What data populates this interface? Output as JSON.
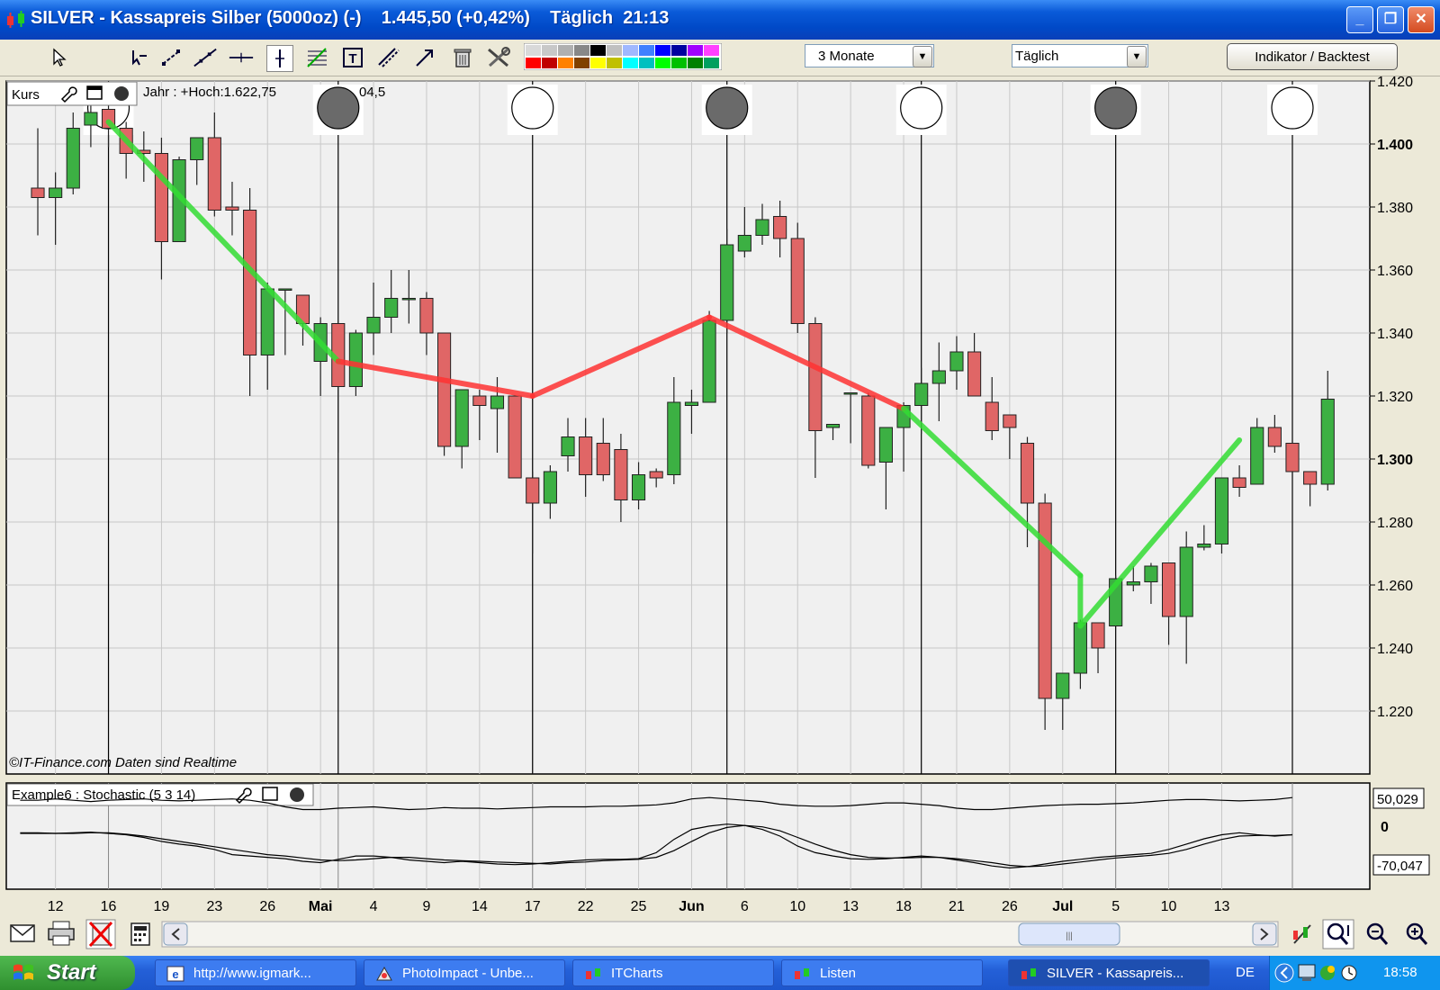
{
  "window": {
    "title": "SILVER - Kassapreis Silber (5000oz) (-)",
    "price": "1.445,50 (+0,42%)",
    "interval": "Täglich",
    "time": "21:13",
    "buttons": {
      "minimize": "_",
      "maximize": "❐",
      "close": "✕"
    }
  },
  "toolbar": {
    "period": "3 Monate",
    "interval": "Täglich",
    "indicator_button": "Indikator / Backtest",
    "palette_top": [
      "#d9d9d9",
      "#c8c8c8",
      "#b0b0b0",
      "#888888",
      "#000000",
      "#c0c0c0",
      "#a0b8ff",
      "#4080ff",
      "#0000ff",
      "#0000a0",
      "#a000ff",
      "#ff40ff"
    ],
    "palette_bottom": [
      "#ff0000",
      "#c00000",
      "#ff8000",
      "#804000",
      "#ffff00",
      "#c0c000",
      "#00ffff",
      "#00c0c0",
      "#00ff00",
      "#00c000",
      "#008000",
      "#00a060"
    ]
  },
  "price_panel": {
    "label": "Kurs",
    "info_left": "Jahr : +Hoch:1.622,75",
    "info_right": "04,5",
    "watermark": "©IT-Finance.com  Daten sind Realtime"
  },
  "osc_panel": {
    "label": "Example6 : Stochastic (5 3 14)",
    "value_top": "50,029",
    "value_zero": "0",
    "value_bottom": "-70,047"
  },
  "colors": {
    "bull": "#3cb043",
    "bear": "#e06666",
    "trend_up": "#33dd33",
    "trend_down": "#ff3333",
    "grid": "#c8c8c8",
    "chart_bg": "#f0f0f0"
  },
  "chart_data": {
    "type": "candlestick",
    "ylim": [
      1200,
      1420
    ],
    "y_ticks": [
      1220,
      1240,
      1260,
      1280,
      1300,
      1320,
      1340,
      1360,
      1380,
      1400,
      1420
    ],
    "y_tick_labels": [
      "1.220",
      "1.240",
      "1.260",
      "1.280",
      "1.300",
      "1.320",
      "1.340",
      "1.360",
      "1.380",
      "1.400",
      "1.420"
    ],
    "x_labels": [
      {
        "i": 1,
        "t": "12"
      },
      {
        "i": 4,
        "t": "16"
      },
      {
        "i": 7,
        "t": "19"
      },
      {
        "i": 10,
        "t": "23"
      },
      {
        "i": 13,
        "t": "26"
      },
      {
        "i": 16,
        "t": "Mai",
        "bold": true
      },
      {
        "i": 19,
        "t": "4"
      },
      {
        "i": 22,
        "t": "9"
      },
      {
        "i": 25,
        "t": "14"
      },
      {
        "i": 28,
        "t": "17"
      },
      {
        "i": 31,
        "t": "22"
      },
      {
        "i": 34,
        "t": "25"
      },
      {
        "i": 37,
        "t": "Jun",
        "bold": true
      },
      {
        "i": 40,
        "t": "6"
      },
      {
        "i": 43,
        "t": "10"
      },
      {
        "i": 46,
        "t": "13"
      },
      {
        "i": 49,
        "t": "18"
      },
      {
        "i": 52,
        "t": "21"
      },
      {
        "i": 55,
        "t": "26"
      },
      {
        "i": 58,
        "t": "Jul",
        "bold": true
      },
      {
        "i": 61,
        "t": "5"
      },
      {
        "i": 64,
        "t": "10"
      },
      {
        "i": 67,
        "t": "13"
      }
    ],
    "candles": [
      {
        "o": 1386,
        "h": 1405,
        "l": 1371,
        "c": 1383
      },
      {
        "o": 1383,
        "h": 1391,
        "l": 1368,
        "c": 1386
      },
      {
        "o": 1386,
        "h": 1410,
        "l": 1384,
        "c": 1405
      },
      {
        "o": 1406,
        "h": 1413,
        "l": 1399,
        "c": 1410
      },
      {
        "o": 1411,
        "h": 1416,
        "l": 1399,
        "c": 1405
      },
      {
        "o": 1405,
        "h": 1407,
        "l": 1389,
        "c": 1397
      },
      {
        "o": 1398,
        "h": 1404,
        "l": 1388,
        "c": 1397
      },
      {
        "o": 1397,
        "h": 1402,
        "l": 1357,
        "c": 1369
      },
      {
        "o": 1369,
        "h": 1396,
        "l": 1369,
        "c": 1395
      },
      {
        "o": 1395,
        "h": 1402,
        "l": 1387,
        "c": 1402
      },
      {
        "o": 1402,
        "h": 1410,
        "l": 1377,
        "c": 1379
      },
      {
        "o": 1380,
        "h": 1388,
        "l": 1371,
        "c": 1379
      },
      {
        "o": 1379,
        "h": 1386,
        "l": 1320,
        "c": 1333
      },
      {
        "o": 1333,
        "h": 1356,
        "l": 1322,
        "c": 1354
      },
      {
        "o": 1354,
        "h": 1354,
        "l": 1333,
        "c": 1354
      },
      {
        "o": 1352,
        "h": 1352,
        "l": 1336,
        "c": 1343
      },
      {
        "o": 1331,
        "h": 1345,
        "l": 1320,
        "c": 1343
      },
      {
        "o": 1343,
        "h": 1340,
        "l": 1302,
        "c": 1323
      },
      {
        "o": 1323,
        "h": 1341,
        "l": 1320,
        "c": 1340
      },
      {
        "o": 1340,
        "h": 1356,
        "l": 1333,
        "c": 1345
      },
      {
        "o": 1345,
        "h": 1360,
        "l": 1340,
        "c": 1351
      },
      {
        "o": 1351,
        "h": 1360,
        "l": 1343,
        "c": 1351
      },
      {
        "o": 1351,
        "h": 1353,
        "l": 1333,
        "c": 1340
      },
      {
        "o": 1340,
        "h": 1340,
        "l": 1301,
        "c": 1304
      },
      {
        "o": 1304,
        "h": 1322,
        "l": 1297,
        "c": 1322
      },
      {
        "o": 1320,
        "h": 1322,
        "l": 1306,
        "c": 1317
      },
      {
        "o": 1316,
        "h": 1326,
        "l": 1302,
        "c": 1320
      },
      {
        "o": 1320,
        "h": 1320,
        "l": 1294,
        "c": 1294
      },
      {
        "o": 1294,
        "h": 1296,
        "l": 1270,
        "c": 1286
      },
      {
        "o": 1286,
        "h": 1298,
        "l": 1281,
        "c": 1296
      },
      {
        "o": 1301,
        "h": 1313,
        "l": 1296,
        "c": 1307
      },
      {
        "o": 1307,
        "h": 1313,
        "l": 1288,
        "c": 1295
      },
      {
        "o": 1305,
        "h": 1313,
        "l": 1293,
        "c": 1295
      },
      {
        "o": 1303,
        "h": 1308,
        "l": 1280,
        "c": 1287
      },
      {
        "o": 1287,
        "h": 1299,
        "l": 1284,
        "c": 1295
      },
      {
        "o": 1296,
        "h": 1297,
        "l": 1291,
        "c": 1294
      },
      {
        "o": 1295,
        "h": 1326,
        "l": 1292,
        "c": 1318
      },
      {
        "o": 1317,
        "h": 1322,
        "l": 1308,
        "c": 1318
      },
      {
        "o": 1318,
        "h": 1347,
        "l": 1318,
        "c": 1344
      },
      {
        "o": 1344,
        "h": 1373,
        "l": 1340,
        "c": 1368
      },
      {
        "o": 1366,
        "h": 1380,
        "l": 1364,
        "c": 1371
      },
      {
        "o": 1371,
        "h": 1381,
        "l": 1368,
        "c": 1376
      },
      {
        "o": 1377,
        "h": 1382,
        "l": 1364,
        "c": 1370
      },
      {
        "o": 1370,
        "h": 1375,
        "l": 1340,
        "c": 1343
      },
      {
        "o": 1343,
        "h": 1345,
        "l": 1294,
        "c": 1309
      },
      {
        "o": 1310,
        "h": 1310,
        "l": 1306,
        "c": 1311
      },
      {
        "o": 1321,
        "h": 1321,
        "l": 1305,
        "c": 1321
      },
      {
        "o": 1320,
        "h": 1321,
        "l": 1297,
        "c": 1298
      },
      {
        "o": 1299,
        "h": 1309,
        "l": 1284,
        "c": 1310
      },
      {
        "o": 1310,
        "h": 1318,
        "l": 1296,
        "c": 1317
      },
      {
        "o": 1317,
        "h": 1329,
        "l": 1308,
        "c": 1324
      },
      {
        "o": 1324,
        "h": 1337,
        "l": 1312,
        "c": 1328
      },
      {
        "o": 1328,
        "h": 1339,
        "l": 1322,
        "c": 1334
      },
      {
        "o": 1334,
        "h": 1340,
        "l": 1320,
        "c": 1320
      },
      {
        "o": 1318,
        "h": 1326,
        "l": 1306,
        "c": 1309
      },
      {
        "o": 1314,
        "h": 1314,
        "l": 1300,
        "c": 1310
      },
      {
        "o": 1305,
        "h": 1307,
        "l": 1272,
        "c": 1286
      },
      {
        "o": 1286,
        "h": 1289,
        "l": 1214,
        "c": 1224
      },
      {
        "o": 1224,
        "h": 1232,
        "l": 1214,
        "c": 1232
      },
      {
        "o": 1232,
        "h": 1249,
        "l": 1227,
        "c": 1248
      },
      {
        "o": 1248,
        "h": 1248,
        "l": 1232,
        "c": 1240
      },
      {
        "o": 1247,
        "h": 1263,
        "l": 1247,
        "c": 1262
      },
      {
        "o": 1260,
        "h": 1266,
        "l": 1258,
        "c": 1261
      },
      {
        "o": 1261,
        "h": 1267,
        "l": 1254,
        "c": 1266
      },
      {
        "o": 1267,
        "h": 1267,
        "l": 1241,
        "c": 1250
      },
      {
        "o": 1250,
        "h": 1277,
        "l": 1235,
        "c": 1272
      },
      {
        "o": 1272,
        "h": 1279,
        "l": 1271,
        "c": 1273
      },
      {
        "o": 1273,
        "h": 1294,
        "l": 1270,
        "c": 1294
      },
      {
        "o": 1294,
        "h": 1298,
        "l": 1288,
        "c": 1291
      },
      {
        "o": 1292,
        "h": 1313,
        "l": 1292,
        "c": 1310
      },
      {
        "o": 1310,
        "h": 1314,
        "l": 1302,
        "c": 1304
      },
      {
        "o": 1305,
        "h": 1306,
        "l": 1295,
        "c": 1296
      },
      {
        "o": 1296,
        "h": 1296,
        "l": 1285,
        "c": 1292
      },
      {
        "o": 1292,
        "h": 1328,
        "l": 1290,
        "c": 1319
      }
    ],
    "trend_line": [
      {
        "i": 4,
        "y": 1407,
        "dir": "up"
      },
      {
        "i": 17,
        "y": 1331,
        "dir": "down"
      },
      {
        "i": 28,
        "y": 1320,
        "dir": "down"
      },
      {
        "i": 38,
        "y": 1345,
        "dir": "down"
      },
      {
        "i": 49,
        "y": 1316,
        "dir": "up"
      },
      {
        "i": 59,
        "y": 1263,
        "dir": "up"
      },
      {
        "i": 59,
        "y": 1247,
        "dir": "up"
      },
      {
        "i": 68,
        "y": 1306,
        "dir": "up"
      }
    ],
    "cycle_markers": [
      {
        "i": 4,
        "filled": false
      },
      {
        "i": 17,
        "filled": true
      },
      {
        "i": 28,
        "filled": false
      },
      {
        "i": 39,
        "filled": true
      },
      {
        "i": 50,
        "filled": false
      },
      {
        "i": 61,
        "filled": true
      },
      {
        "i": 71,
        "filled": false
      }
    ],
    "osc_ylim": [
      -90,
      70
    ],
    "osc_line_top": [
      44,
      44,
      46,
      44,
      42,
      44,
      45,
      46,
      44,
      43,
      44,
      45,
      46,
      44,
      40,
      34,
      30,
      30,
      32,
      33,
      34,
      32,
      30,
      31,
      33,
      32,
      32,
      31,
      32,
      33,
      34,
      34,
      34,
      35,
      35,
      36,
      37,
      40,
      46,
      48,
      46,
      44,
      42,
      38,
      36,
      35,
      35,
      36,
      38,
      40,
      40,
      38,
      36,
      32,
      30,
      30,
      32,
      34,
      36,
      37,
      38,
      38,
      39,
      40,
      42,
      44,
      45,
      45,
      44,
      43,
      44,
      45,
      48
    ],
    "osc_line_k": [
      -5,
      -5,
      -6,
      -5,
      -4,
      -6,
      -8,
      -12,
      -18,
      -22,
      -25,
      -30,
      -38,
      -40,
      -42,
      -44,
      -48,
      -50,
      -45,
      -40,
      -40,
      -42,
      -46,
      -48,
      -50,
      -48,
      -50,
      -52,
      -53,
      -52,
      -50,
      -48,
      -46,
      -45,
      -45,
      -44,
      -35,
      -15,
      0,
      5,
      8,
      6,
      0,
      -10,
      -25,
      -35,
      -40,
      -44,
      -45,
      -44,
      -42,
      -40,
      -42,
      -46,
      -50,
      -55,
      -58,
      -56,
      -52,
      -48,
      -45,
      -42,
      -40,
      -38,
      -36,
      -30,
      -22,
      -14,
      -8,
      -5,
      -8,
      -10,
      -8
    ],
    "osc_line_d": [
      -6,
      -6,
      -6,
      -6,
      -5,
      -5,
      -7,
      -10,
      -14,
      -18,
      -22,
      -26,
      -30,
      -34,
      -38,
      -40,
      -43,
      -46,
      -47,
      -46,
      -44,
      -42,
      -42,
      -44,
      -46,
      -47,
      -48,
      -49,
      -50,
      -51,
      -52,
      -50,
      -49,
      -47,
      -46,
      -45,
      -42,
      -32,
      -18,
      -5,
      3,
      6,
      4,
      -2,
      -12,
      -22,
      -31,
      -38,
      -42,
      -43,
      -43,
      -42,
      -42,
      -44,
      -47,
      -50,
      -54,
      -56,
      -55,
      -52,
      -49,
      -46,
      -43,
      -41,
      -39,
      -36,
      -30,
      -22,
      -15,
      -10,
      -9,
      -9,
      -8
    ]
  },
  "scrollbar": {
    "grip": "|||"
  },
  "taskbar": {
    "start": "Start",
    "tasks": [
      {
        "label": "http://www.igmark...",
        "active": false
      },
      {
        "label": "PhotoImpact - Unbe...",
        "active": false
      },
      {
        "label": "ITCharts",
        "active": false
      },
      {
        "label": "Listen",
        "active": false
      },
      {
        "label": "SILVER - Kassapreis...",
        "active": true
      }
    ],
    "lang": "DE",
    "clock": "18:58"
  }
}
